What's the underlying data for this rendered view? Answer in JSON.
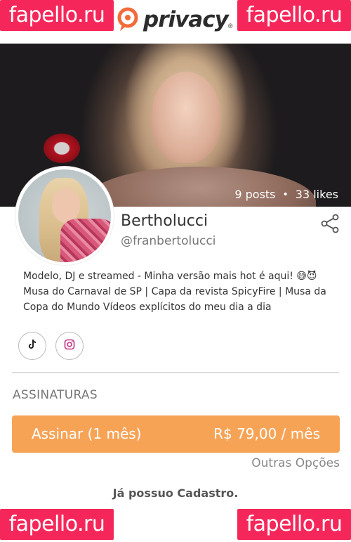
{
  "watermark": {
    "text": "fapello.ru"
  },
  "header": {
    "logo_text": "privacy",
    "logo_reg": "®"
  },
  "cover": {
    "posts": "9 posts",
    "separator": "•",
    "likes": "33 likes"
  },
  "profile": {
    "name": "Bertholucci",
    "handle": "@franbertolucci",
    "bio": "Modelo, DJ e streamed - Minha versão mais hot é aqui! 😅😈 Musa do Carnaval de SP | Capa da revista SpicyFire | Musa da Copa do Mundo Vídeos explícitos do meu dia a dia"
  },
  "social": {
    "icons": [
      "tiktok-icon",
      "instagram-icon"
    ]
  },
  "subscriptions": {
    "title": "ASSINATURAS",
    "button_label": "Assinar (1 mês)",
    "button_price": "R$ 79,00 / mês",
    "other_options": "Outras Opções",
    "already_registered": "Já possuo Cadastro."
  },
  "colors": {
    "brand_orange": "#f7a356",
    "watermark_pink": "#f5275a",
    "logo_orange": "#f26b3a"
  }
}
